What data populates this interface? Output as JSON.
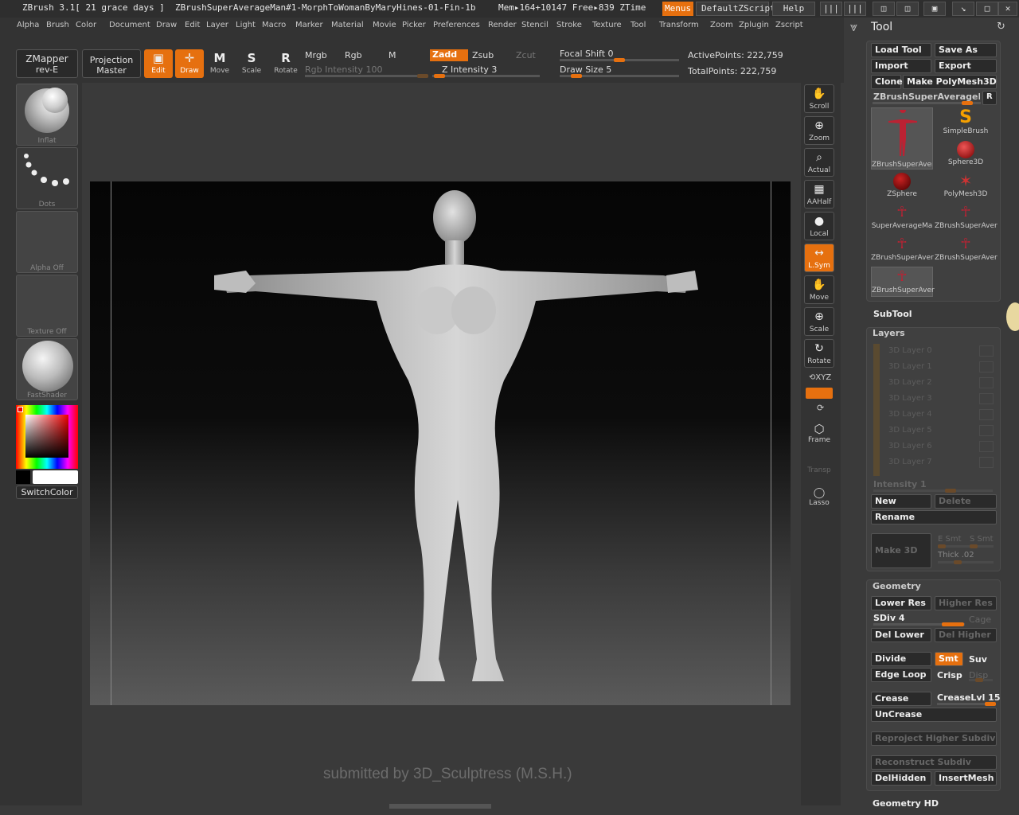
{
  "titlebar": {
    "app": "ZBrush  3.1[ 21 grace days ]",
    "doc": "ZBrushSuperAverageMan#1-MorphToWomanByMaryHines-01-Fin-1b",
    "mem": "Mem▸164+10147 Free▸839 ZTime",
    "menus": "Menus",
    "script": "DefaultZScript",
    "help": "Help"
  },
  "menubar": [
    "Alpha",
    "Brush",
    "Color",
    "Document",
    "Draw",
    "Edit",
    "Layer",
    "Light",
    "Macro",
    "Marker",
    "Material",
    "Movie",
    "Picker",
    "Preferences",
    "Render",
    "Stencil",
    "Stroke",
    "Texture",
    "Tool",
    "Transform",
    "Zoom",
    "Zplugin",
    "Zscript"
  ],
  "shelf": {
    "zmapper": [
      "ZMapper",
      "rev-E"
    ],
    "projection": [
      "Projection",
      "Master"
    ],
    "tools": [
      {
        "glyph": "▣",
        "label": "Edit",
        "on": true
      },
      {
        "glyph": "✛",
        "label": "Draw",
        "on": true
      },
      {
        "glyph": "M",
        "label": "Move",
        "on": false
      },
      {
        "glyph": "S",
        "label": "Scale",
        "on": false
      },
      {
        "glyph": "R",
        "label": "Rotate",
        "on": false
      }
    ],
    "mrgb": "Mrgb",
    "rgb": "Rgb",
    "m": "M",
    "zadd": "Zadd",
    "zsub": "Zsub",
    "zcut": "Zcut",
    "rgb_intensity": "Rgb  Intensity 100",
    "z_intensity": "Z Intensity 3",
    "focal_shift": "Focal Shift 0",
    "draw_size": "Draw Size 5",
    "active_points": "ActivePoints: 222,759",
    "total_points": "TotalPoints: 222,759"
  },
  "lefttray": {
    "tiles": [
      "Inflat",
      "Dots",
      "Alpha  Off",
      "Texture  Off",
      "FastShader"
    ],
    "switch_color": "SwitchColor"
  },
  "canvas": {
    "credit": "submitted by 3D_Sculptress (M.S.H.)"
  },
  "rightbar": [
    {
      "glyph": "✋",
      "label": "Scroll",
      "on": false
    },
    {
      "glyph": "⊕",
      "label": "Zoom",
      "on": false
    },
    {
      "glyph": "⌕",
      "label": "Actual",
      "on": false
    },
    {
      "glyph": "▦",
      "label": "AAHalf",
      "on": false
    },
    {
      "glyph": "●",
      "label": "Local",
      "on": false
    },
    {
      "glyph": "↔",
      "label": "L.Sym",
      "on": true
    },
    {
      "glyph": "✋",
      "label": "Move",
      "on": false
    },
    {
      "glyph": "⊕",
      "label": "Scale",
      "on": false
    },
    {
      "glyph": "↻",
      "label": "Rotate",
      "on": false
    }
  ],
  "rightbar_small": {
    "xyz": "⟲XYZ",
    "frame": "Frame",
    "transp": "Transp",
    "lasso": "Lasso"
  },
  "tool": {
    "title": "Tool",
    "load": "Load Tool",
    "save": "Save As",
    "import": "Import",
    "export": "Export",
    "clone": "Clone",
    "make_polymesh": "Make PolyMesh3D",
    "current": "ZBrushSuperAverageMa",
    "r": "R",
    "thumbs": [
      "ZBrushSuperAver",
      "SimpleBrush",
      "",
      "Sphere3D",
      "ZSphere",
      "PolyMesh3D",
      "SuperAverageMa",
      "ZBrushSuperAver",
      "ZBrushSuperAver",
      "ZBrushSuperAver",
      "ZBrushSuperAver"
    ],
    "subtool": "SubTool"
  },
  "layers": {
    "title": "Layers",
    "items": [
      "3D Layer 0",
      "3D Layer 1",
      "3D Layer 2",
      "3D Layer 3",
      "3D Layer 4",
      "3D Layer 5",
      "3D Layer 6",
      "3D Layer 7"
    ],
    "intensity": "Intensity 1",
    "new": "New",
    "delete": "Delete",
    "rename": "Rename",
    "make3d": "Make 3D",
    "esmt": "E Smt",
    "ssmt": "S Smt",
    "thick": "Thick .02"
  },
  "geometry": {
    "title": "Geometry",
    "lower": "Lower Res",
    "higher": "Higher Res",
    "sdiv": "SDiv 4",
    "cage": "Cage",
    "del_lower": "Del Lower",
    "del_higher": "Del Higher",
    "divide": "Divide",
    "smt": "Smt",
    "suv": "Suv",
    "edge_loop": "Edge Loop",
    "crisp": "Crisp",
    "disp": "Disp",
    "crease": "Crease",
    "crease_lvl": "CreaseLvl 15",
    "uncrease": "UnCrease",
    "reproject": "Reproject Higher Subdiv",
    "reconstruct": "Reconstruct Subdiv",
    "delhidden": "DelHidden",
    "insertmesh": "InsertMesh",
    "geometry_hd": "Geometry HD"
  }
}
